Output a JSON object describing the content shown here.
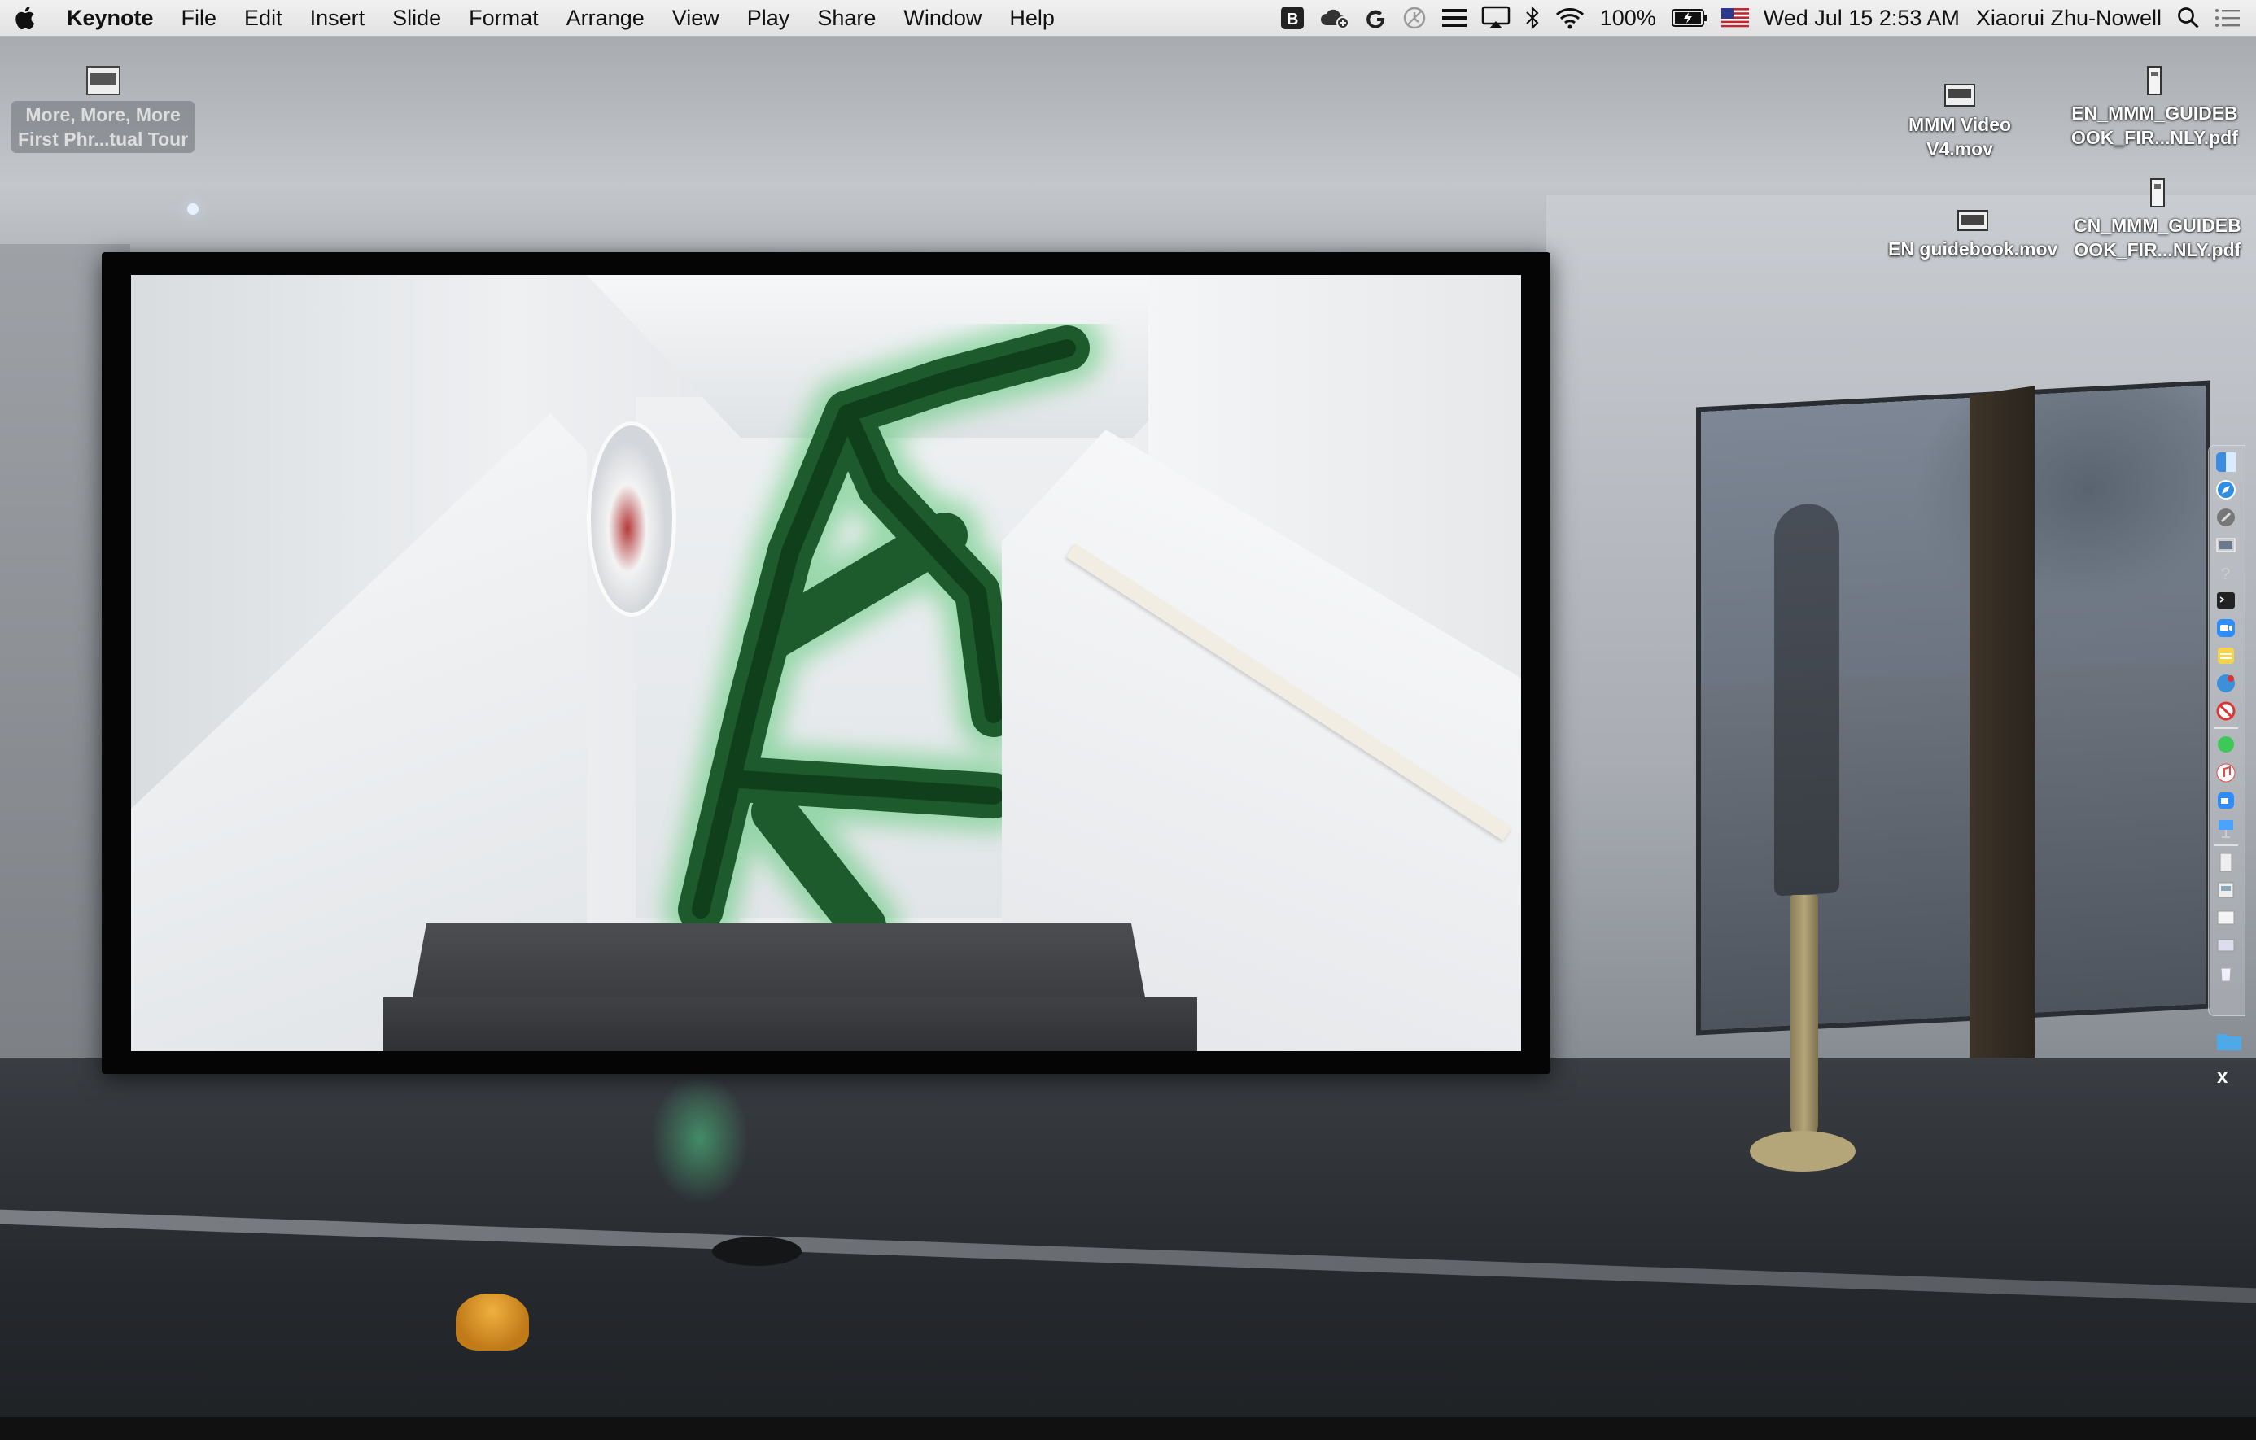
{
  "menubar": {
    "app_name": "Keynote",
    "menus": [
      "File",
      "Edit",
      "Insert",
      "Slide",
      "Format",
      "Arrange",
      "View",
      "Play",
      "Share",
      "Window",
      "Help"
    ],
    "status": {
      "battery": "100%",
      "datetime": "Wed Jul 15  2:53 AM",
      "user": "Xiaorui Zhu-Nowell",
      "input_flag": "us-flag-icon"
    }
  },
  "desktop": {
    "icons": {
      "tour": {
        "line1": "More, More, More",
        "line2": "First Phr...tual Tour"
      },
      "mmm_video": {
        "line1": "MMM Video",
        "line2": "V4.mov"
      },
      "en_pdf": {
        "line1": "EN_MMM_GUIDEB",
        "line2": "OOK_FIR...NLY.pdf"
      },
      "en_guidebook": {
        "line1": "EN guidebook.mov"
      },
      "cn_pdf": {
        "line1": "CN_MMM_GUIDEB",
        "line2": "OOK_FIR...NLY.pdf"
      }
    },
    "dock_close_label": "x"
  },
  "colors": {
    "menubar_bg": "#e6e6e6",
    "moss_green": "#1d5a2c",
    "moss_glow": "#38c15a"
  }
}
